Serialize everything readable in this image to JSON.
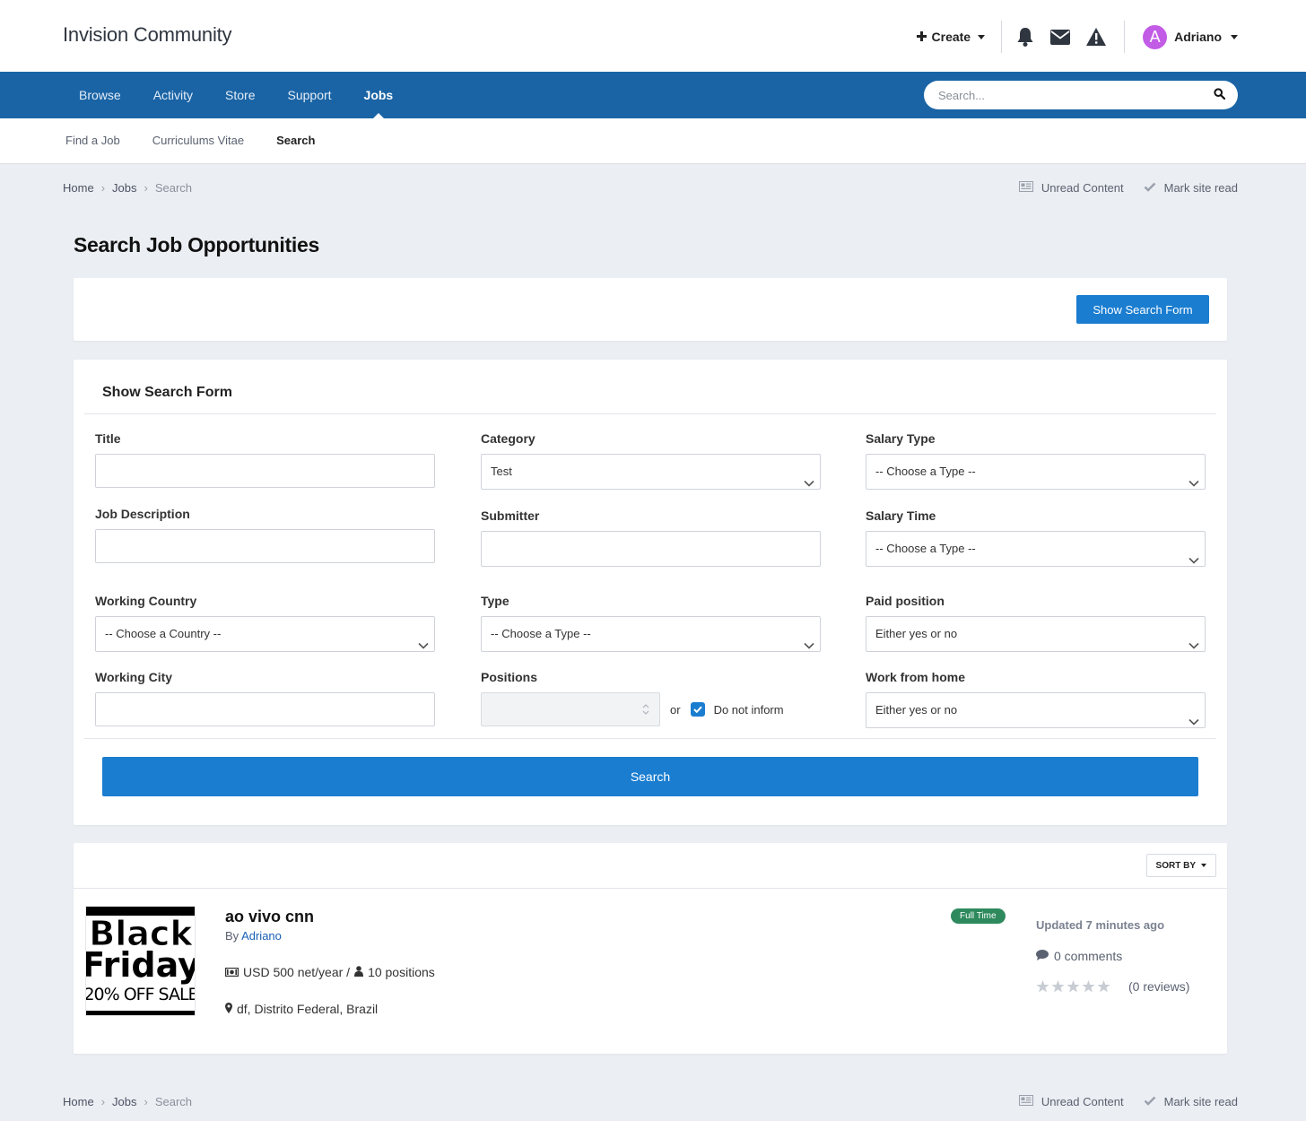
{
  "header": {
    "site_title": "Invision Community",
    "create_label": "Create",
    "user_name": "Adriano",
    "avatar_letter": "A",
    "avatar_color": "#c25be6"
  },
  "nav": {
    "items": [
      {
        "label": "Browse"
      },
      {
        "label": "Activity"
      },
      {
        "label": "Store"
      },
      {
        "label": "Support"
      },
      {
        "label": "Jobs",
        "active": true
      }
    ],
    "search_placeholder": "Search...",
    "bg_color": "#1a64a5"
  },
  "subnav": {
    "items": [
      {
        "label": "Find a Job"
      },
      {
        "label": "Curriculums Vitae"
      },
      {
        "label": "Search",
        "active": true
      }
    ]
  },
  "breadcrumb": {
    "items": [
      "Home",
      "Jobs",
      "Search"
    ],
    "unread_label": "Unread Content",
    "mark_read_label": "Mark site read"
  },
  "page": {
    "title": "Search Job Opportunities",
    "show_form_button": "Show Search Form"
  },
  "form": {
    "title": "Show Search Form",
    "title_label": "Title",
    "title_value": "",
    "description_label": "Job Description",
    "description_value": "",
    "country_label": "Working Country",
    "country_value": "-- Choose a Country --",
    "city_label": "Working City",
    "city_value": "",
    "category_label": "Category",
    "category_value": "Test",
    "submitter_label": "Submitter",
    "submitter_value": "",
    "type_label": "Type",
    "type_value": "-- Choose a Type --",
    "positions_label": "Positions",
    "or_label": "or",
    "do_not_inform_label": "Do not inform",
    "do_not_inform_checked": true,
    "salary_type_label": "Salary Type",
    "salary_type_value": "-- Choose a Type --",
    "salary_time_label": "Salary Time",
    "salary_time_value": "-- Choose a Type --",
    "paid_label": "Paid position",
    "paid_value": "Either yes or no",
    "wfh_label": "Work from home",
    "wfh_value": "Either yes or no",
    "search_button": "Search"
  },
  "results": {
    "sort_label": "SORT BY",
    "items": [
      {
        "title": "ao vivo cnn",
        "by_label": "By",
        "author": "Adriano",
        "salary": "USD 500 net/year /",
        "positions": "10 positions",
        "location": "df, Distrito Federal, Brazil",
        "badge": "Full Time",
        "badge_color": "#2e8a5d",
        "updated": "Updated 7 minutes ago",
        "comments": "0 comments",
        "reviews": "(0 reviews)",
        "rating": 0,
        "thumb_line1": "Black",
        "thumb_line2": "Friday",
        "thumb_line3": "20% OFF SALE"
      }
    ]
  }
}
